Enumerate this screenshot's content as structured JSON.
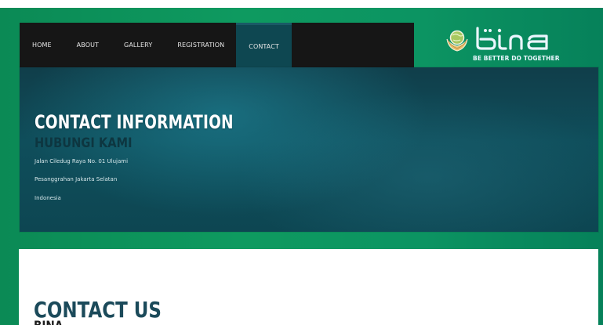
{
  "nav": {
    "items": [
      {
        "label": "HOME"
      },
      {
        "label": "ABOUT"
      },
      {
        "label": "GALLERY"
      },
      {
        "label": "REGISTRATION"
      },
      {
        "label": "CONTACT",
        "active": true
      }
    ]
  },
  "logo": {
    "brand": "bina",
    "tagline": "BE BETTER DO TOGETHER",
    "icon": "globe-in-hands-icon"
  },
  "hero": {
    "title": "CONTACT INFORMATION",
    "subtitle": "HUBUNGI KAMI",
    "address_lines": [
      "Jalan Ciledug Raya No. 01 Ulujami",
      "Pesanggrahan Jakarta Selatan",
      "Indonesia"
    ]
  },
  "contact_card": {
    "title": "CONTACT US",
    "subtitle": "BINA"
  },
  "colors": {
    "background_green": "#0e9a60",
    "nav_bg": "#161616",
    "nav_active_bg": "#0e4751",
    "hero_bg": "#0f4e5b",
    "card_title": "#1b4a5a"
  }
}
